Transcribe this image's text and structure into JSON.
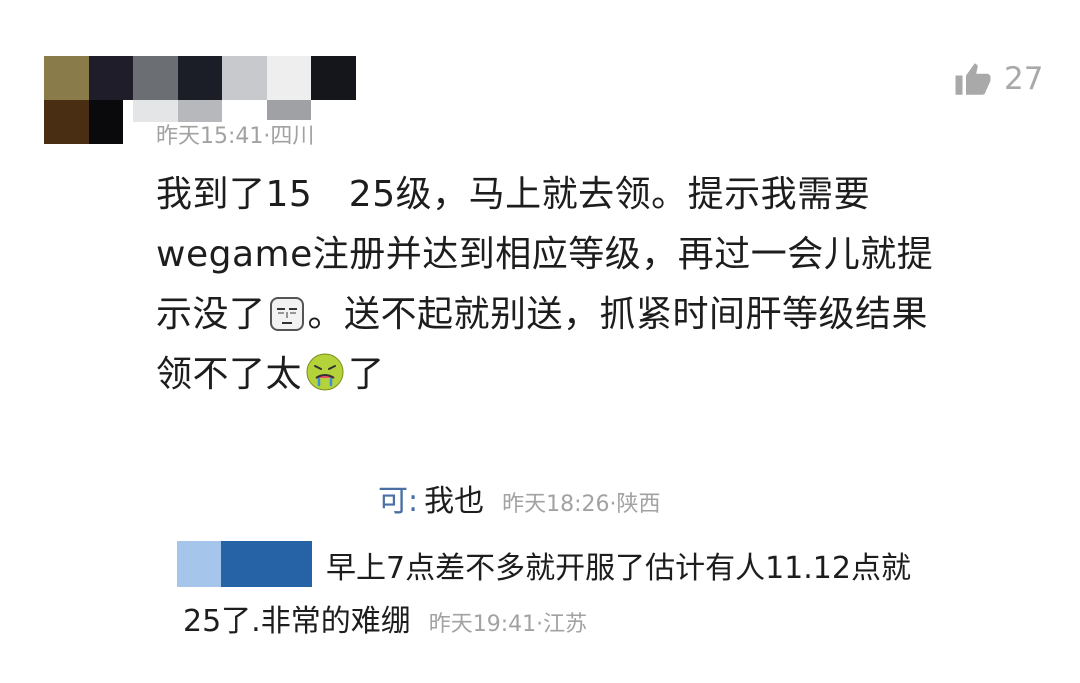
{
  "comment": {
    "meta": "昨天15:41·四川",
    "likes": "27",
    "lines": [
      "我到了15　25级，马上就去领。提示我需要",
      "wegame注册并达到相应等级，再过一会儿就提",
      "示没了",
      "。送不起就别送，抓紧时间肝等级结果",
      "领不了太",
      "了"
    ],
    "emoji_1": "expressionless-face",
    "emoji_2": "nauseated-face"
  },
  "reply_1": {
    "name_fragment": "可:",
    "text": "我也",
    "meta": "昨天18:26·陕西"
  },
  "reply_2": {
    "text_line_1": "早上7点差不多就开服了估计有人11.12点就",
    "text_line_2": "25了.非常的难绷",
    "meta": "昨天19:41·江苏"
  },
  "colors": {
    "meta_gray": "#a2a2a2",
    "name_blue": "#4a6fa5",
    "like_gray": "#a9a9a9"
  }
}
